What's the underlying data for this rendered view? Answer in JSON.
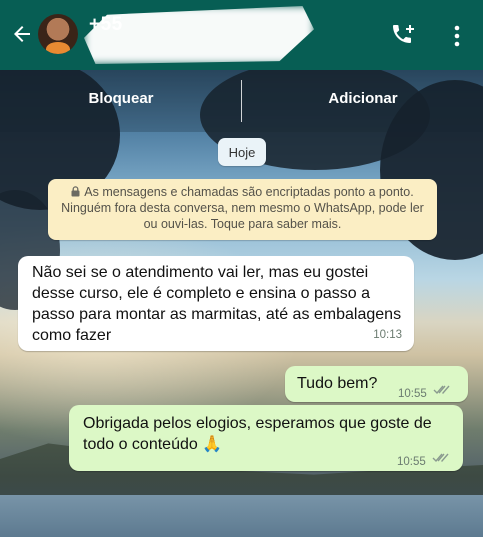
{
  "header": {
    "phone_prefix": "+55",
    "background": "#075e54"
  },
  "actions": {
    "block_label": "Bloquear",
    "add_label": "Adicionar"
  },
  "chat": {
    "date_chip": "Hoje",
    "encryption_notice": "As mensagens e chamadas são encriptadas ponto a ponto. Ninguém fora desta conversa, nem mesmo o WhatsApp, pode ler ou ouvi-las. Toque para saber mais.",
    "messages": [
      {
        "direction": "incoming",
        "text": "Não sei se o atendimento vai ler, mas eu gostei desse curso, ele é completo e ensina o passo a passo para montar as marmitas, até as embalagens como fazer",
        "time": "10:13"
      },
      {
        "direction": "outgoing",
        "text": "Tudo bem?",
        "time": "10:55",
        "status": "read-double-check-icon"
      },
      {
        "direction": "outgoing",
        "text": "Obrigada pelos elogios, esperamos que goste de todo o conteúdo 🙏",
        "time": "10:55",
        "status": "read-double-check-icon"
      }
    ]
  },
  "icons": {
    "back": "back-arrow-icon",
    "call": "add-call-icon",
    "menu": "more-vertical-icon",
    "lock": "lock-icon"
  }
}
